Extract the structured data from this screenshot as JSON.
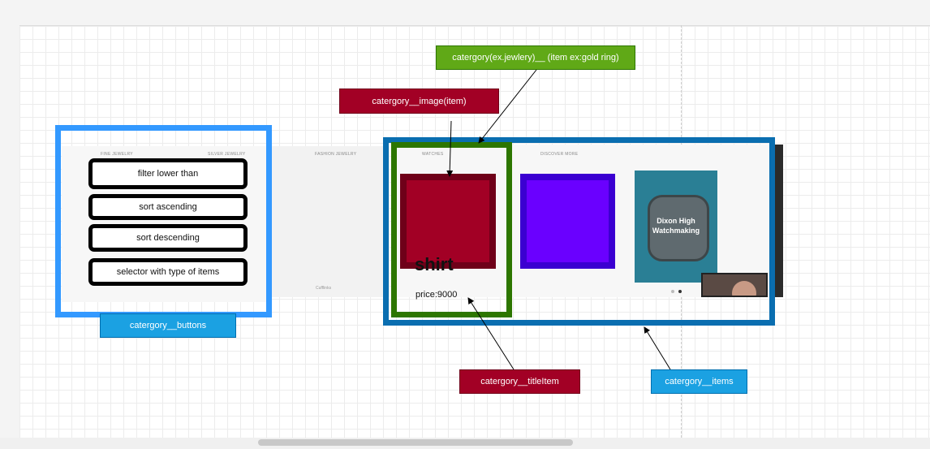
{
  "colors": {
    "button_frame": "#3399ff",
    "items_frame": "#0a6eb0",
    "title_frame": "#2d7600",
    "item_image": "#a20025",
    "item_image_secondary": "#6a00ff",
    "watch_tile": "#2a7f95"
  },
  "buttons": [
    {
      "label": "filter lower than"
    },
    {
      "label": "sort ascending"
    },
    {
      "label": "sort descending"
    },
    {
      "label": "selector with type of items"
    }
  ],
  "screenshot": {
    "nav": [
      "FINE JEWELRY",
      "SILVER JEWELRY",
      "FASHION JEWELRY",
      "WATCHES",
      "DISCOVER MORE"
    ],
    "footer_link": "Cufflinks",
    "watch_caption_line1": "Dixon High",
    "watch_caption_line2": "Watchmaking"
  },
  "item": {
    "title": "shirt",
    "price": "price:9000"
  },
  "labels": {
    "category_item": "catergory(ex.jewlery)__ (item ex:gold ring)",
    "category_image": "catergory__image(item)",
    "category_buttons": "catergory__buttons",
    "category_title_item": "catergory__titleItem",
    "category_items": "catergory__items"
  }
}
